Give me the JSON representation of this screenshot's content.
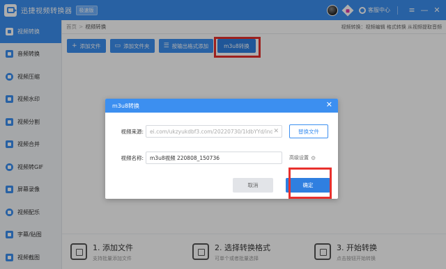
{
  "app": {
    "title": "迅捷视频转换器",
    "edition": "极速版",
    "support_label": "客服中心"
  },
  "window_controls": {
    "menu": "≡",
    "minimize": "—",
    "close": "✕"
  },
  "sidebar": {
    "items": [
      {
        "label": "视频转换",
        "active": true
      },
      {
        "label": "音频转换"
      },
      {
        "label": "视频压缩"
      },
      {
        "label": "视频水印"
      },
      {
        "label": "视频分割"
      },
      {
        "label": "视频合并"
      },
      {
        "label": "视频转GIF"
      },
      {
        "label": "屏幕录像"
      },
      {
        "label": "视频配乐"
      },
      {
        "label": "字幕/贴图"
      },
      {
        "label": "视频截图"
      }
    ]
  },
  "breadcrumb": {
    "home": "首页",
    "sep": ">",
    "current": "视频转换",
    "tip": "视频转换：视频编辑 格式转换 从视频提取音频"
  },
  "toolbar": {
    "add_file": "添加文件",
    "add_folder": "添加文件夹",
    "add_by_format": "按输出格式添加",
    "m3u8": "m3u8转换"
  },
  "steps": [
    {
      "title": "1. 添加文件",
      "desc": "支持批量添加文件"
    },
    {
      "title": "2. 选择转换格式",
      "desc": "可单个或者批量选择"
    },
    {
      "title": "3. 开始转换",
      "desc": "点击按钮开始转换"
    }
  ],
  "dialog": {
    "title": "m3u8转换",
    "close": "✕",
    "source_label": "视频来源:",
    "source_value": "ei.com/ukzyukdbf3.com/20220730/1IdbYYd/index.m3u8",
    "clear": "✕",
    "replace_button": "替换文件",
    "name_label": "视频名称:",
    "name_value": "m3u8视频 220808_150736",
    "advanced": "高级设置",
    "advanced_icon": "⚙",
    "cancel": "取消",
    "confirm": "确定"
  },
  "colors": {
    "primary": "#3c8ff0",
    "highlight": "#e8302d",
    "sidebar_bg": "#f4f6f9"
  }
}
